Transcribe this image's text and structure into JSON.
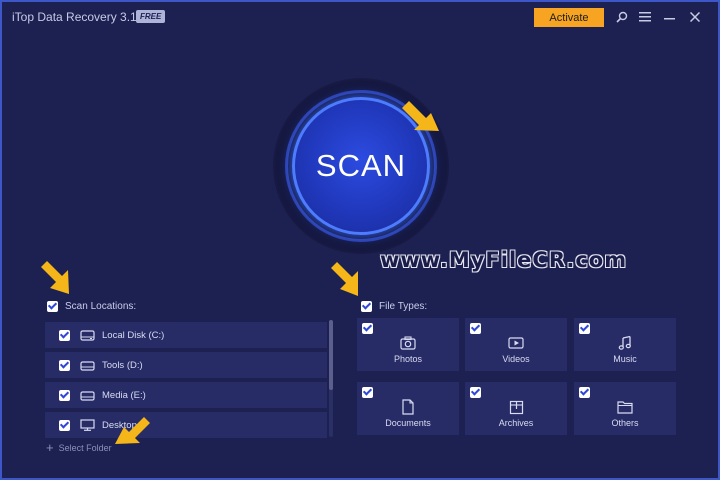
{
  "titlebar": {
    "app_title": "iTop Data Recovery 3.1",
    "badge": "FREE",
    "activate_label": "Activate",
    "icons": [
      "search-icon",
      "menu-icon",
      "minimize-icon",
      "close-icon"
    ]
  },
  "scan_button": {
    "label": "SCAN"
  },
  "watermark": "www.MyFileCR.com",
  "scan_locations": {
    "header": "Scan Locations:",
    "items": [
      {
        "label": "Local Disk (C:)",
        "icon": "drive-icon"
      },
      {
        "label": "Tools (D:)",
        "icon": "drive-icon"
      },
      {
        "label": "Media (E:)",
        "icon": "drive-icon"
      },
      {
        "label": "Desktop",
        "icon": "desktop-icon"
      }
    ],
    "select_folder": "Select Folder"
  },
  "file_types": {
    "header": "File Types:",
    "items": [
      {
        "label": "Photos",
        "icon": "camera-icon"
      },
      {
        "label": "Videos",
        "icon": "video-icon"
      },
      {
        "label": "Music",
        "icon": "music-note-icon"
      },
      {
        "label": "Documents",
        "icon": "document-icon"
      },
      {
        "label": "Archives",
        "icon": "archive-icon"
      },
      {
        "label": "Others",
        "icon": "folder-icon"
      }
    ]
  },
  "colors": {
    "background": "#1d2152",
    "accent": "#f6a422",
    "scan_blue": "#1f36b8",
    "panel": "#272c66",
    "annotation_arrow": "#f5b61a"
  }
}
